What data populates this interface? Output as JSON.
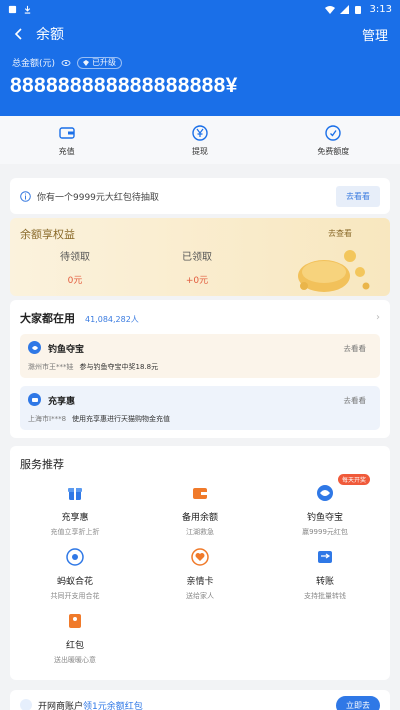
{
  "statusbar": {
    "time": "3:13"
  },
  "header": {
    "title": "余额",
    "manage_label": "管理",
    "total_label": "总金额(元)",
    "badge_label": "已升级",
    "amount": "888888888888888888¥"
  },
  "actions": [
    {
      "label": "充值",
      "icon": "recharge-icon"
    },
    {
      "label": "提现",
      "icon": "withdraw-icon"
    },
    {
      "label": "免费额度",
      "icon": "free-quota-icon"
    }
  ],
  "notice": {
    "text": "你有一个9999元大红包待抽取",
    "button": "去看看"
  },
  "rights": {
    "title": "余额享权益",
    "more": "去查看",
    "pending_label": "待领取",
    "pending_value": "0元",
    "received_label": "已领取",
    "received_value": "+0元"
  },
  "popular": {
    "title": "大家都在用",
    "count": "41,084,282人",
    "items": [
      {
        "name": "钓鱼夺宝",
        "go": "去看看",
        "desc_user": "滁州市王***娃",
        "desc_text": "参与钓鱼夺宝中奖18.8元"
      },
      {
        "name": "充享惠",
        "go": "去看看",
        "desc_user": "上海市I***8",
        "desc_text": "使用充享惠进行天猫购物金充值"
      }
    ]
  },
  "services": {
    "title": "服务推荐",
    "items": [
      {
        "name": "充享惠",
        "sub": "充值立享折上折",
        "icon": "gift-box-icon"
      },
      {
        "name": "备用余额",
        "sub": "江湖救急",
        "icon": "wallet-icon"
      },
      {
        "name": "钓鱼夺宝",
        "sub": "赢9999元红包",
        "icon": "fishing-icon",
        "tag": "每天开奖"
      },
      {
        "name": "蚂蚁合花",
        "sub": "共同开支用合花",
        "icon": "flower-icon"
      },
      {
        "name": "亲情卡",
        "sub": "送给家人",
        "icon": "heart-icon"
      },
      {
        "name": "转账",
        "sub": "支持批量转钱",
        "icon": "transfer-icon"
      },
      {
        "name": "红包",
        "sub": "送出暖暖心意",
        "icon": "red-packet-icon"
      }
    ]
  },
  "footer": {
    "text_prefix": "开网商账户",
    "text_highlight": "领1元余额红包",
    "button": "立即去"
  },
  "colors": {
    "primary": "#1a6fe8",
    "orange": "#f07a2a",
    "red": "#f05a3a",
    "gold": "#8a6a2a"
  }
}
